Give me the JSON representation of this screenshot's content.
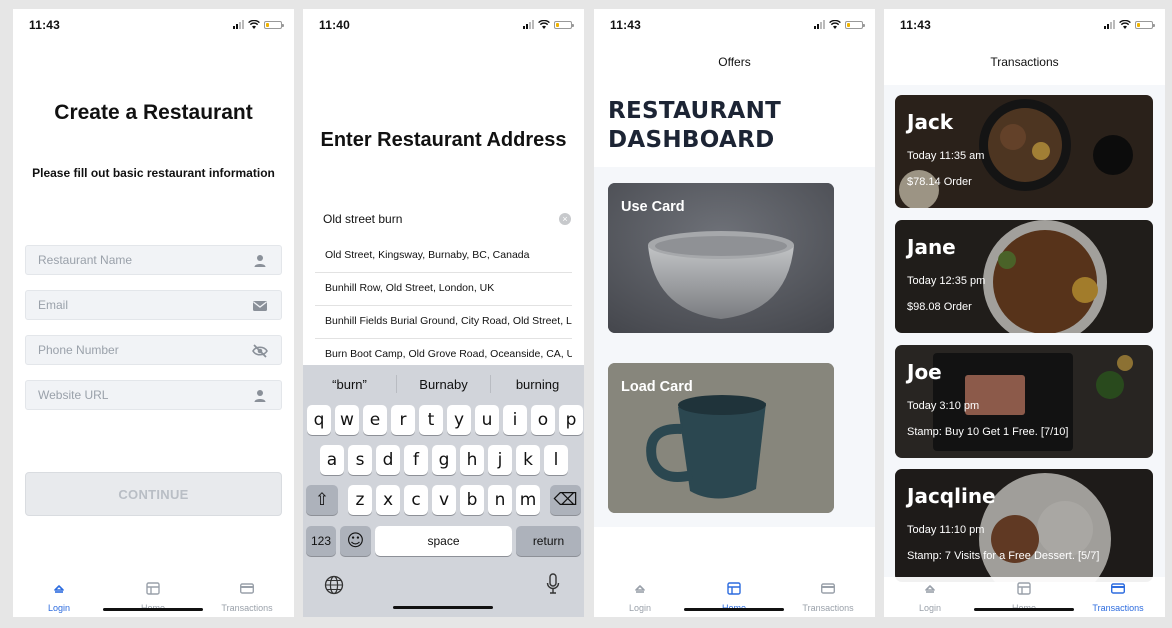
{
  "screens": [
    {
      "status": {
        "time": "11:43"
      },
      "title": "Create a Restaurant",
      "subtitle": "Please fill out basic restaurant information",
      "fields": [
        {
          "placeholder": "Restaurant Name",
          "icon": "person-icon"
        },
        {
          "placeholder": "Email",
          "icon": "envelope-icon"
        },
        {
          "placeholder": "Phone Number",
          "icon": "eye-off-icon"
        },
        {
          "placeholder": "Website URL",
          "icon": "person-icon"
        }
      ],
      "continue_label": "CONTINUE",
      "tabs": [
        "Login",
        "Home",
        "Transactions"
      ],
      "active_tab": "Login"
    },
    {
      "status": {
        "time": "11:40"
      },
      "title": "Enter Restaurant Address",
      "address_value": "Old street burn",
      "suggestions": [
        "Old Street, Kingsway, Burnaby, BC, Canada",
        "Bunhill Row, Old Street, London, UK",
        "Bunhill Fields Burial Ground, City Road, Old Street, L",
        "Burn Boot Camp, Old Grove Road, Oceanside, CA, U"
      ],
      "keyboard": {
        "predictions": [
          "“burn”",
          "Burnaby",
          "burning"
        ],
        "row1": [
          "q",
          "w",
          "e",
          "r",
          "t",
          "y",
          "u",
          "i",
          "o",
          "p"
        ],
        "row2": [
          "a",
          "s",
          "d",
          "f",
          "g",
          "h",
          "j",
          "k",
          "l"
        ],
        "row3": [
          "z",
          "x",
          "c",
          "v",
          "b",
          "n",
          "m"
        ],
        "numbers_label": "123",
        "emoji_label": "☺",
        "space_label": "space",
        "return_label": "return",
        "shift_label": "⇧",
        "delete_label": "⌫"
      }
    },
    {
      "status": {
        "time": "11:43"
      },
      "nav_title": "Offers",
      "dashboard_line1": "RESTAURANT",
      "dashboard_line2": "DASHBOARD",
      "cards": [
        "Use Card",
        "Load Card"
      ],
      "tabs": [
        "Login",
        "Home",
        "Transactions"
      ],
      "active_tab": "Home"
    },
    {
      "status": {
        "time": "11:43"
      },
      "nav_title": "Transactions",
      "transactions": [
        {
          "name": "Jack",
          "time": "Today 11:35 am",
          "detail": "$78.14 Order"
        },
        {
          "name": "Jane",
          "time": "Today 12:35 pm",
          "detail": "$98.08 Order"
        },
        {
          "name": "Joe",
          "time": "Today 3:10 pm",
          "detail": "Stamp: Buy 10 Get 1 Free. [7/10]"
        },
        {
          "name": "Jacqline",
          "time": "Today 11:10 pm",
          "detail": "Stamp: 7 Visits for a Free Dessert. [5/7]"
        }
      ],
      "tabs": [
        "Login",
        "Home",
        "Transactions"
      ],
      "active_tab": "Transactions"
    }
  ],
  "colors": {
    "accent": "#2d6cdf",
    "dashboard_text": "#1c2434",
    "inactive_tab": "#9aa1aa"
  }
}
